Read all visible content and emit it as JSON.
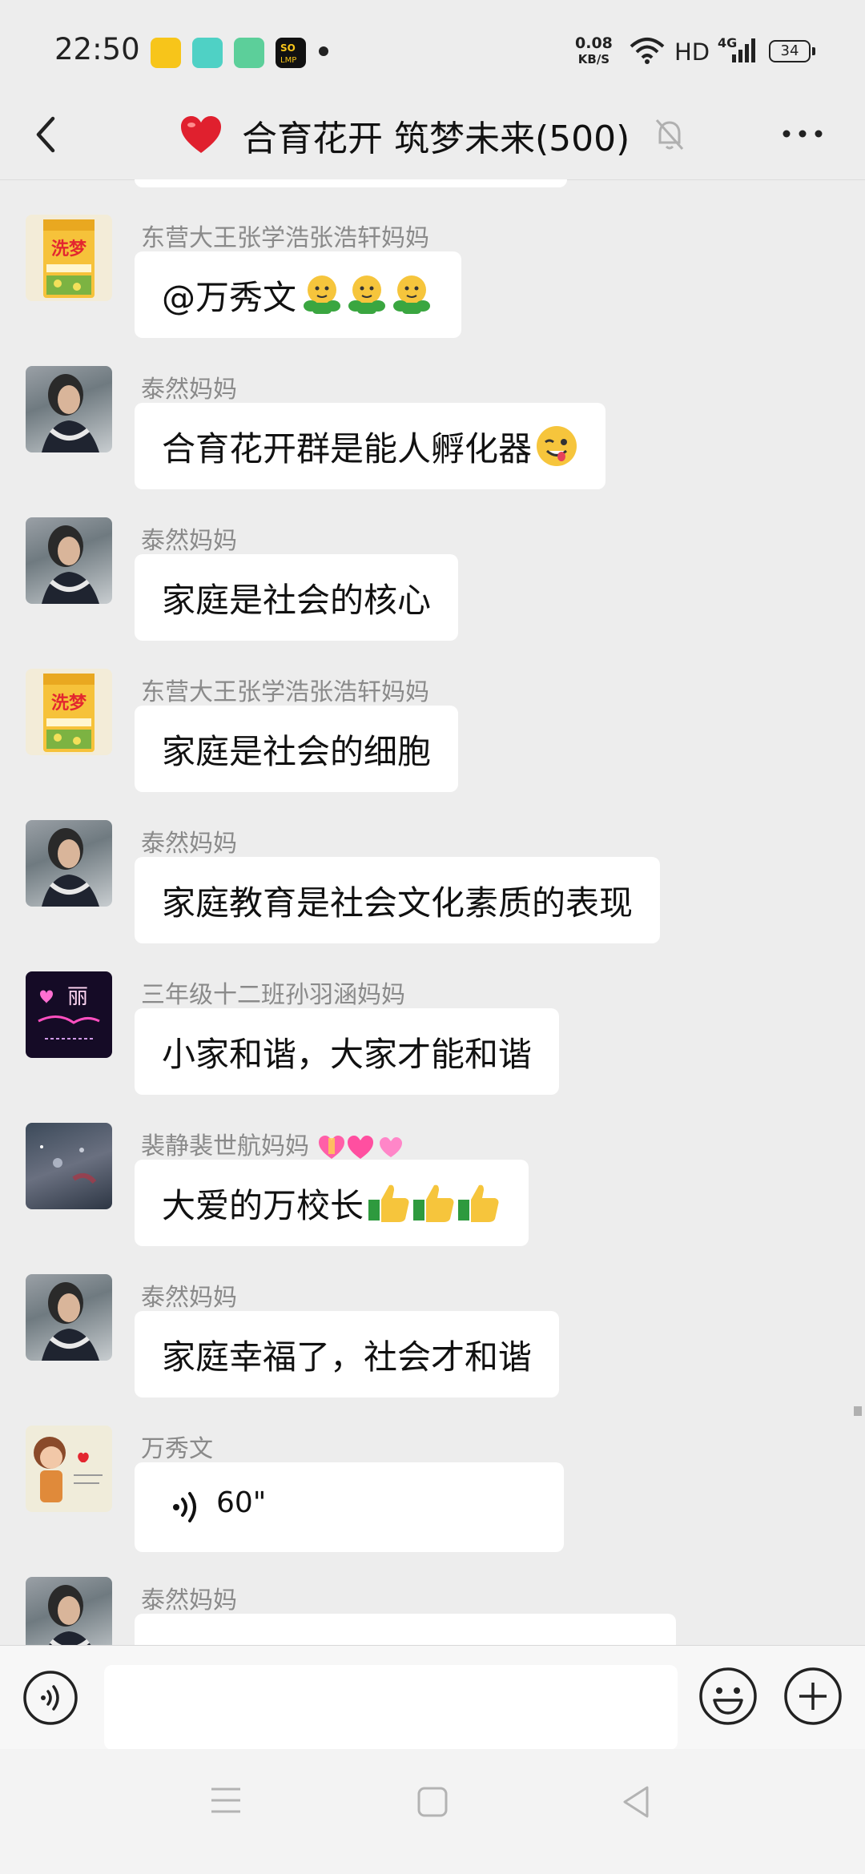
{
  "status": {
    "time": "22:50",
    "net_speed_value": "0.08",
    "net_speed_unit": "KB/S",
    "hd": "HD",
    "network": "4G",
    "battery": "34"
  },
  "header": {
    "title": "合育花开 筑梦未来(500)",
    "icons": [
      "back-icon",
      "heart-icon",
      "mute-bell-icon",
      "more-icon"
    ]
  },
  "messages": [
    {
      "sender": "东营大王张学浩张浩轩妈妈",
      "text": "@万秀文 ",
      "emoji": "hugging-face"
    },
    {
      "sender": "泰然妈妈",
      "text": "合育花开群是能人孵化器",
      "emoji": "winking-face"
    },
    {
      "sender": "泰然妈妈",
      "text": "家庭是社会的核心"
    },
    {
      "sender": "东营大王张学浩张浩轩妈妈",
      "text": "家庭是社会的细胞"
    },
    {
      "sender": "泰然妈妈",
      "text": "家庭教育是社会文化素质的表现"
    },
    {
      "sender": "三年级十二班孙羽涵妈妈",
      "text": "小家和谐，大家才能和谐"
    },
    {
      "sender": "裴静裴世航妈妈",
      "text": "大爱的万校长",
      "emoji": "thumbs-up"
    },
    {
      "sender": "泰然妈妈",
      "text": "家庭幸福了，社会才和谐"
    },
    {
      "sender": "万秀文",
      "voice_duration": "60\""
    },
    {
      "sender": "泰然妈妈"
    }
  ],
  "avatars": {
    "rice_bag_text": "洗梦",
    "neon_text": "丽"
  },
  "input": {
    "placeholder": "",
    "value": ""
  },
  "colors": {
    "background": "#ededed",
    "bubble": "#ffffff",
    "sender_text": "#8a8a8a"
  }
}
